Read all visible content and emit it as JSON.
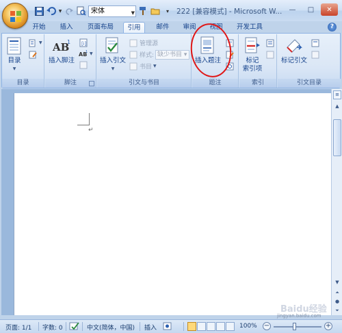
{
  "window": {
    "title": "222 [兼容模式] - Microsoft W...",
    "controls": {
      "minimize": "—",
      "maximize": "□",
      "close": "✕"
    }
  },
  "qat": {
    "font_name": "宋体"
  },
  "tabs": [
    {
      "label": "开始"
    },
    {
      "label": "插入"
    },
    {
      "label": "页面布局"
    },
    {
      "label": "引用",
      "active": true
    },
    {
      "label": "邮件"
    },
    {
      "label": "审阅"
    },
    {
      "label": "视图"
    },
    {
      "label": "开发工具"
    }
  ],
  "ribbon": {
    "toc": {
      "title": "目录",
      "btn_label": "目录"
    },
    "footnote": {
      "title": "脚注",
      "insert_label": "插入脚注"
    },
    "citations": {
      "title": "引文与书目",
      "insert_citation": "插入引文",
      "manage_sources": "管理源",
      "style_label": "样式:",
      "style_value": "缺少书目",
      "bibliography": "书目"
    },
    "captions": {
      "title": "题注",
      "insert_caption": "插入题注"
    },
    "index": {
      "title": "索引",
      "mark_entry_line1": "标记",
      "mark_entry_line2": "索引项"
    },
    "toa": {
      "title": "引文目录",
      "mark_citation": "标记引文"
    }
  },
  "status": {
    "page": "页面: 1/1",
    "words": "字数: 0",
    "language": "中文(简体，中国)",
    "mode": "插入",
    "zoom": "100%"
  },
  "watermark": {
    "main": "Baidu经验",
    "sub": "jingyan.baidu.com"
  },
  "colors": {
    "accent": "#15428b",
    "highlight": "#e01616",
    "ribbon_bg": "#dbe7f6"
  }
}
